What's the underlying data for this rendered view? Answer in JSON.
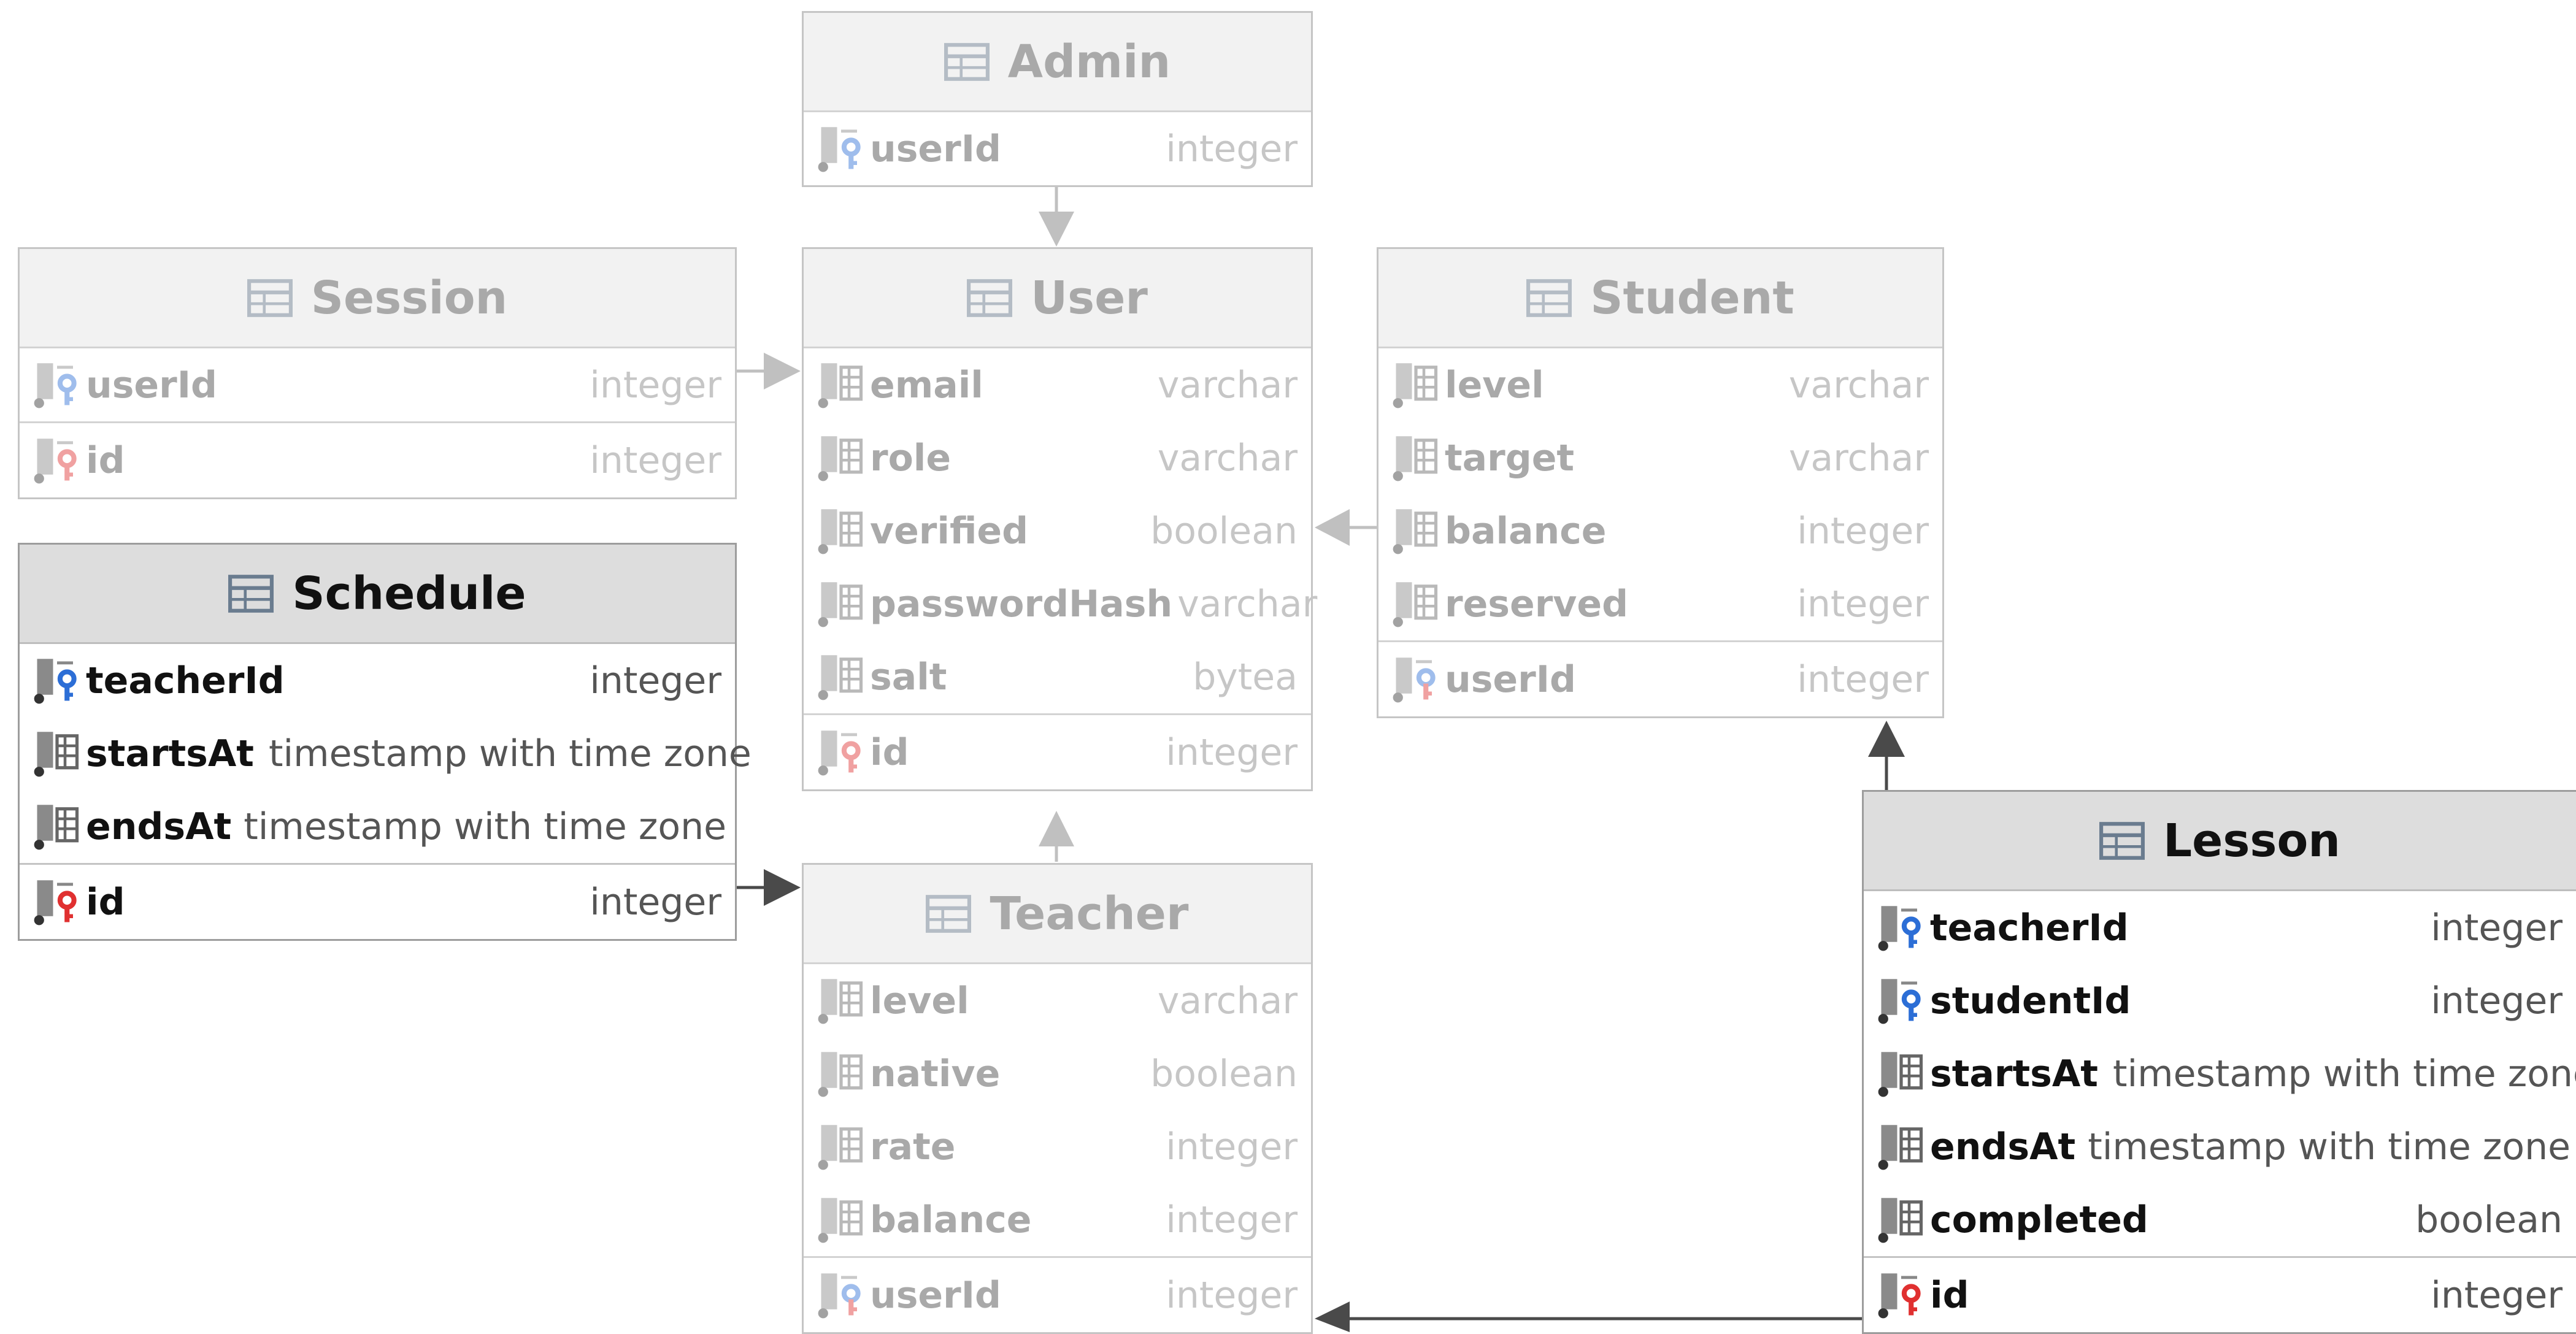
{
  "diagram": {
    "tables": {
      "admin": {
        "title": "Admin",
        "rows": [
          {
            "name": "userId",
            "type": "integer",
            "icon": "foreign-key-icon"
          }
        ]
      },
      "session": {
        "title": "Session",
        "rows": [
          {
            "name": "userId",
            "type": "integer",
            "icon": "foreign-key-icon"
          },
          {
            "name": "id",
            "type": "integer",
            "icon": "primary-key-icon"
          }
        ]
      },
      "user": {
        "title": "User",
        "rows": [
          {
            "name": "email",
            "type": "varchar",
            "icon": "column-icon"
          },
          {
            "name": "role",
            "type": "varchar",
            "icon": "column-icon"
          },
          {
            "name": "verified",
            "type": "boolean",
            "icon": "column-icon"
          },
          {
            "name": "passwordHash",
            "type": "varchar",
            "icon": "column-icon"
          },
          {
            "name": "salt",
            "type": "bytea",
            "icon": "column-icon"
          },
          {
            "name": "id",
            "type": "integer",
            "icon": "primary-key-icon"
          }
        ]
      },
      "student": {
        "title": "Student",
        "rows": [
          {
            "name": "level",
            "type": "varchar",
            "icon": "column-icon"
          },
          {
            "name": "target",
            "type": "varchar",
            "icon": "column-icon"
          },
          {
            "name": "balance",
            "type": "integer",
            "icon": "column-icon"
          },
          {
            "name": "reserved",
            "type": "integer",
            "icon": "column-icon"
          },
          {
            "name": "userId",
            "type": "integer",
            "icon": "primary-foreign-key-icon"
          }
        ]
      },
      "schedule": {
        "title": "Schedule",
        "rows": [
          {
            "name": "teacherId",
            "type": "integer",
            "icon": "foreign-key-icon"
          },
          {
            "name": "startsAt",
            "type": "timestamp with time zone",
            "icon": "column-icon"
          },
          {
            "name": "endsAt",
            "type": "timestamp with time zone",
            "icon": "column-icon"
          },
          {
            "name": "id",
            "type": "integer",
            "icon": "primary-key-icon"
          }
        ]
      },
      "teacher": {
        "title": "Teacher",
        "rows": [
          {
            "name": "level",
            "type": "varchar",
            "icon": "column-icon"
          },
          {
            "name": "native",
            "type": "boolean",
            "icon": "column-icon"
          },
          {
            "name": "rate",
            "type": "integer",
            "icon": "column-icon"
          },
          {
            "name": "balance",
            "type": "integer",
            "icon": "column-icon"
          },
          {
            "name": "userId",
            "type": "integer",
            "icon": "primary-foreign-key-icon"
          }
        ]
      },
      "lesson": {
        "title": "Lesson",
        "rows": [
          {
            "name": "teacherId",
            "type": "integer",
            "icon": "foreign-key-icon"
          },
          {
            "name": "studentId",
            "type": "integer",
            "icon": "foreign-key-icon"
          },
          {
            "name": "startsAt",
            "type": "timestamp with time zone",
            "icon": "column-icon"
          },
          {
            "name": "endsAt",
            "type": "timestamp with time zone",
            "icon": "column-icon"
          },
          {
            "name": "completed",
            "type": "boolean",
            "icon": "column-icon"
          },
          {
            "name": "id",
            "type": "integer",
            "icon": "primary-key-icon"
          }
        ]
      }
    },
    "relations": [
      {
        "from": "Admin",
        "to": "User",
        "emphasis": "dim"
      },
      {
        "from": "Session",
        "to": "User",
        "emphasis": "dim"
      },
      {
        "from": "Student",
        "to": "User",
        "emphasis": "dim"
      },
      {
        "from": "Teacher",
        "to": "User",
        "emphasis": "dim"
      },
      {
        "from": "Schedule",
        "to": "Teacher",
        "emphasis": "strong"
      },
      {
        "from": "Lesson",
        "to": "Student",
        "emphasis": "strong"
      },
      {
        "from": "Lesson",
        "to": "Teacher",
        "emphasis": "strong"
      }
    ],
    "colors": {
      "strong_line": "#4a4a4a",
      "dim_line": "#c0c0c0",
      "primary_key": "#e03030",
      "foreign_key": "#2c6ed6"
    }
  }
}
